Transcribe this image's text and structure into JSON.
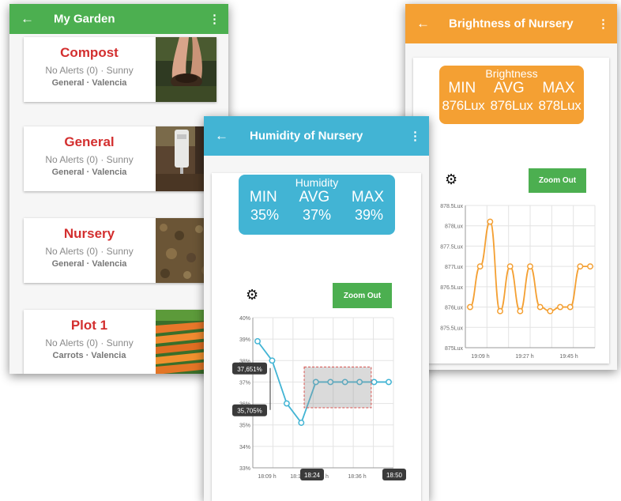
{
  "garden": {
    "title": "My Garden",
    "back_icon": "arrow-left-icon",
    "more_icon": "more-vert-icon",
    "plots": [
      {
        "name": "Compost",
        "alerts": "No Alerts (0) · Sunny",
        "location": "General · Valencia",
        "photo": "compost-photo"
      },
      {
        "name": "General",
        "alerts": "No Alerts (0) · Sunny",
        "location": "General · Valencia",
        "photo": "sensor-photo"
      },
      {
        "name": "Nursery",
        "alerts": "No Alerts (0) · Sunny",
        "location": "General · Valencia",
        "photo": "soil-photo"
      },
      {
        "name": "Plot 1",
        "alerts": "No Alerts (0) · Sunny",
        "location": "Carrots · Valencia",
        "photo": "carrots-photo"
      }
    ]
  },
  "humidity": {
    "title": "Humidity of Nursery",
    "stats_label": "Humidity",
    "headers": [
      "MIN",
      "AVG",
      "MAX"
    ],
    "values": [
      "35%",
      "37%",
      "39%"
    ],
    "zoom_label": "Zoom Out",
    "settings_icon": "gear-icon",
    "tooltips": {
      "top": "37,651%",
      "bottom": "35,705%"
    },
    "range_labels": {
      "start": "18:24",
      "end": "18:50"
    }
  },
  "brightness": {
    "title": "Brightness of Nursery",
    "stats_label": "Brightness",
    "headers": [
      "MIN",
      "AVG",
      "MAX"
    ],
    "values": [
      "876Lux",
      "876Lux",
      "878Lux"
    ],
    "zoom_label": "Zoom Out",
    "settings_icon": "gear-icon"
  },
  "colors": {
    "garden_bar": "#4caf50",
    "humidity_bar": "#42b4d4",
    "brightness_bar": "#f4a033",
    "plot_name": "#d32f2f",
    "zoom_button": "#4caf50"
  },
  "chart_data": [
    {
      "type": "line",
      "name": "humidity",
      "y_ticks": [
        "40%",
        "39%",
        "38%",
        "37%",
        "36%",
        "35%",
        "34%",
        "33%"
      ],
      "ylim": [
        33,
        40
      ],
      "x_ticks": [
        "18:09 h",
        "18:18",
        "h",
        "18:36 h",
        "1"
      ],
      "x": [
        0,
        1,
        2,
        3,
        4,
        5,
        6,
        7,
        8,
        9
      ],
      "y": [
        38.9,
        38.0,
        36.0,
        35.1,
        37.0,
        37.0,
        37.0,
        37.0,
        37.0,
        37.0
      ],
      "color": "#42b4d4"
    },
    {
      "type": "line",
      "name": "brightness",
      "y_ticks": [
        "878.5Lux",
        "878Lux",
        "877.5Lux",
        "877Lux",
        "876.5Lux",
        "876Lux",
        "875.5Lux",
        "875Lux"
      ],
      "ylim": [
        875,
        878.5
      ],
      "x_ticks": [
        "19:09 h",
        "19:27 h",
        "19:45 h"
      ],
      "x": [
        0,
        1,
        2,
        3,
        4,
        5,
        6,
        7,
        8,
        9,
        10,
        11,
        12
      ],
      "y": [
        876.0,
        877.0,
        878.1,
        875.9,
        877.0,
        875.9,
        877.0,
        876.0,
        875.9,
        876.0,
        876.0,
        877.0,
        877.0
      ],
      "color": "#f4a033"
    }
  ]
}
